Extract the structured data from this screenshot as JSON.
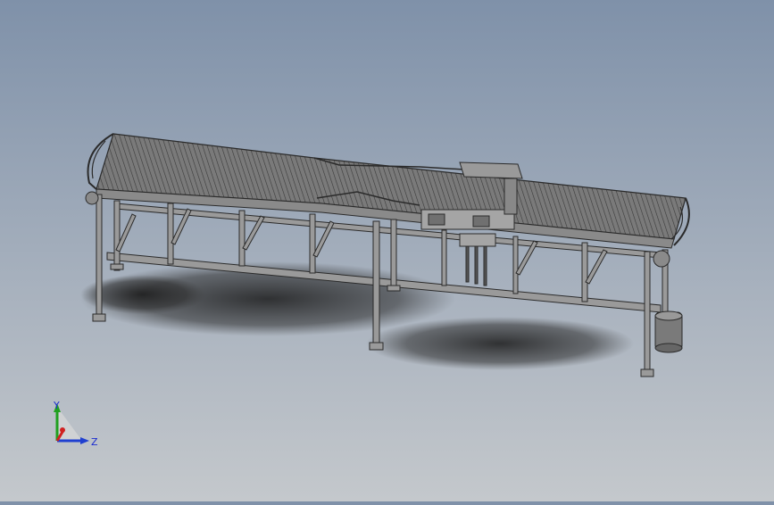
{
  "viewport": {
    "background_top": "#7f91a9",
    "background_bottom": "#c4c8cc",
    "model": {
      "name": "belt conveyor",
      "frame_color": "#8f8f8f",
      "belt_color": "#6d6d6d",
      "outline_color": "#2b2b2b",
      "motor_color": "#777777"
    }
  },
  "triad": {
    "y_label": "Y",
    "z_label": "Z",
    "x_color": "#d02020",
    "y_color": "#20a020",
    "z_color": "#2040d0"
  }
}
